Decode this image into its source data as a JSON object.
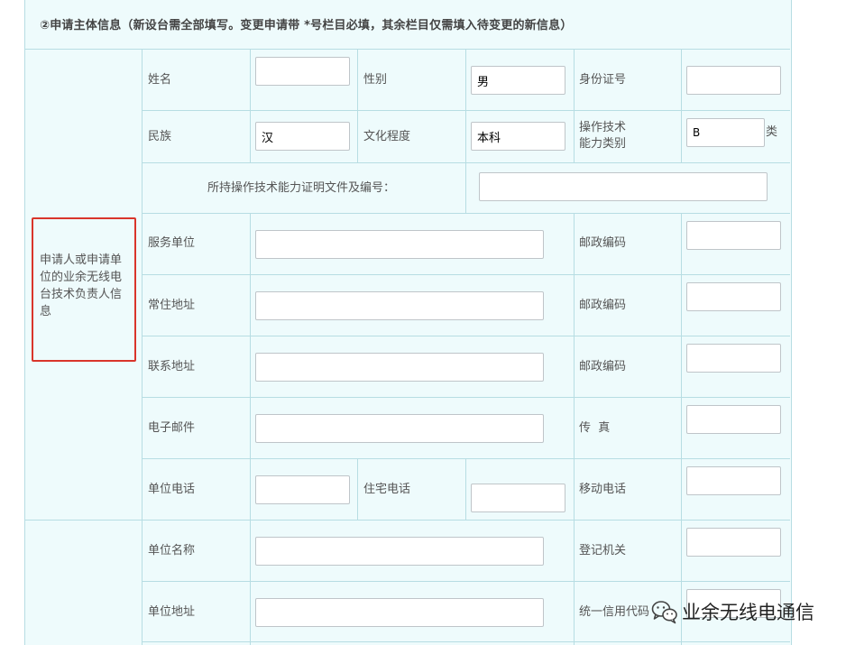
{
  "section_title": "②申请主体信息（新设台需全部填写。变更申请带 *号栏目必填，其余栏目仅需填入待变更的新信息）",
  "group_person": {
    "title": "申请人或申请单位的业余无线电台技术负责人信息",
    "rows": {
      "name_label": "姓名",
      "gender_label": "性别",
      "gender_value": "男",
      "id_label": "身份证号",
      "ethnicity_label": "民族",
      "ethnicity_value": "汉",
      "education_label": "文化程度",
      "education_value": "本科",
      "skill_class_label_line1": "操作技术",
      "skill_class_label_line2": "能力类别",
      "skill_class_value": "B",
      "skill_class_suffix": "类",
      "cert_label": "所持操作技术能力证明文件及编号：",
      "employer_label": "服务单位",
      "postcode1_label": "邮政编码",
      "residence_label": "常住地址",
      "postcode2_label": "邮政编码",
      "contact_address_label": "联系地址",
      "postcode3_label": "邮政编码",
      "email_label": "电子邮件",
      "fax_label": "传  真",
      "work_phone_label": "单位电话",
      "home_phone_label": "住宅电话",
      "mobile_label": "移动电话"
    }
  },
  "group_unit": {
    "unit_name_label": "单位名称",
    "registrar_label": "登记机关",
    "unit_address_label": "单位地址",
    "credit_code_label": "统一信用代码"
  },
  "watermark": {
    "text": "业余无线电通信",
    "icon": "wechat-logo-icon"
  }
}
